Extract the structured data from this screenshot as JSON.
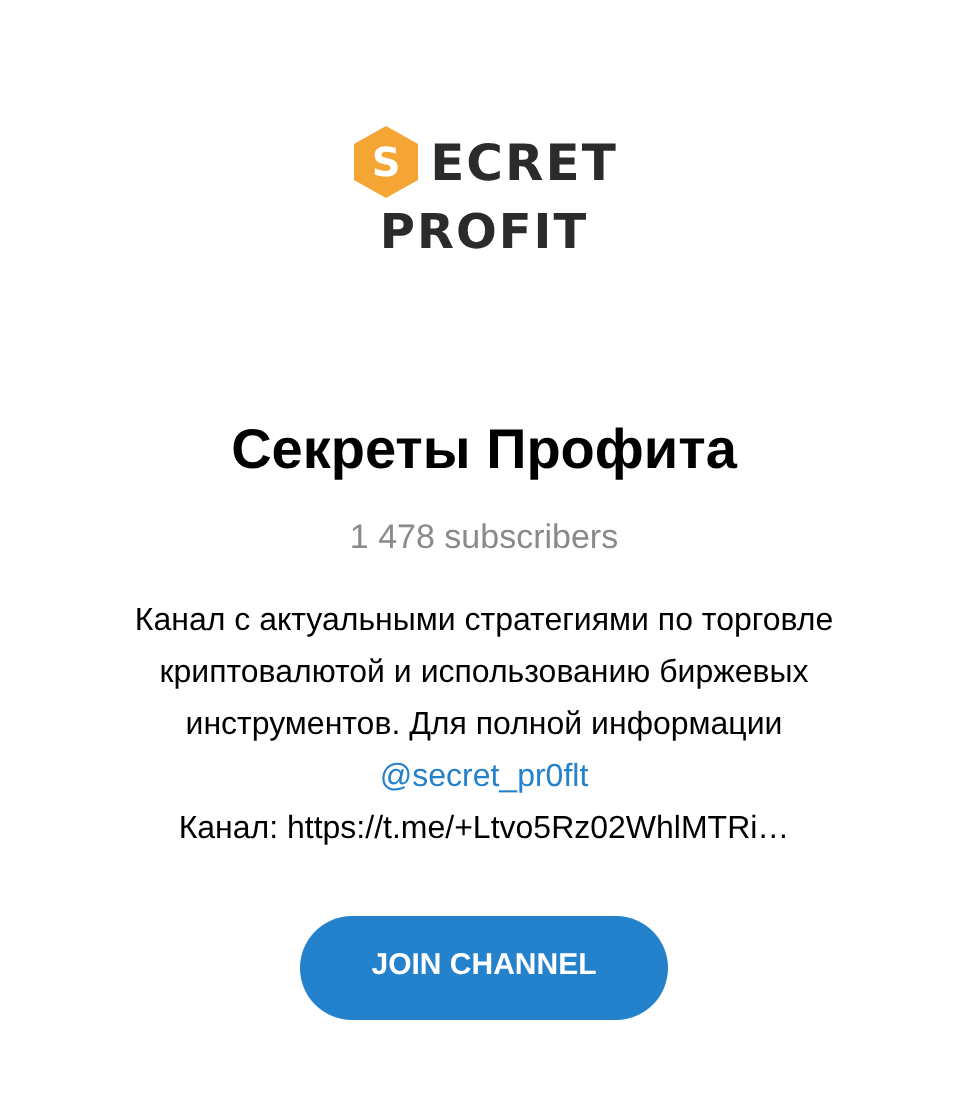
{
  "logo": {
    "badge_letter": "S",
    "line_1": "ECRET",
    "line_2": "PROFIT"
  },
  "title": "Секреты Профита",
  "subscribers": "1 478 subscribers",
  "description": {
    "lines": [
      "Канал с актуальными стратегиями по торговле",
      "криптовалютой и использованию биржевых",
      "инструментов. Для полной информации"
    ],
    "link": "@secret_pr0flt",
    "tail": "Канал: https://t.me/+Ltvo5Rz02WhlMTRi…"
  },
  "button": "JOIN CHANNEL"
}
